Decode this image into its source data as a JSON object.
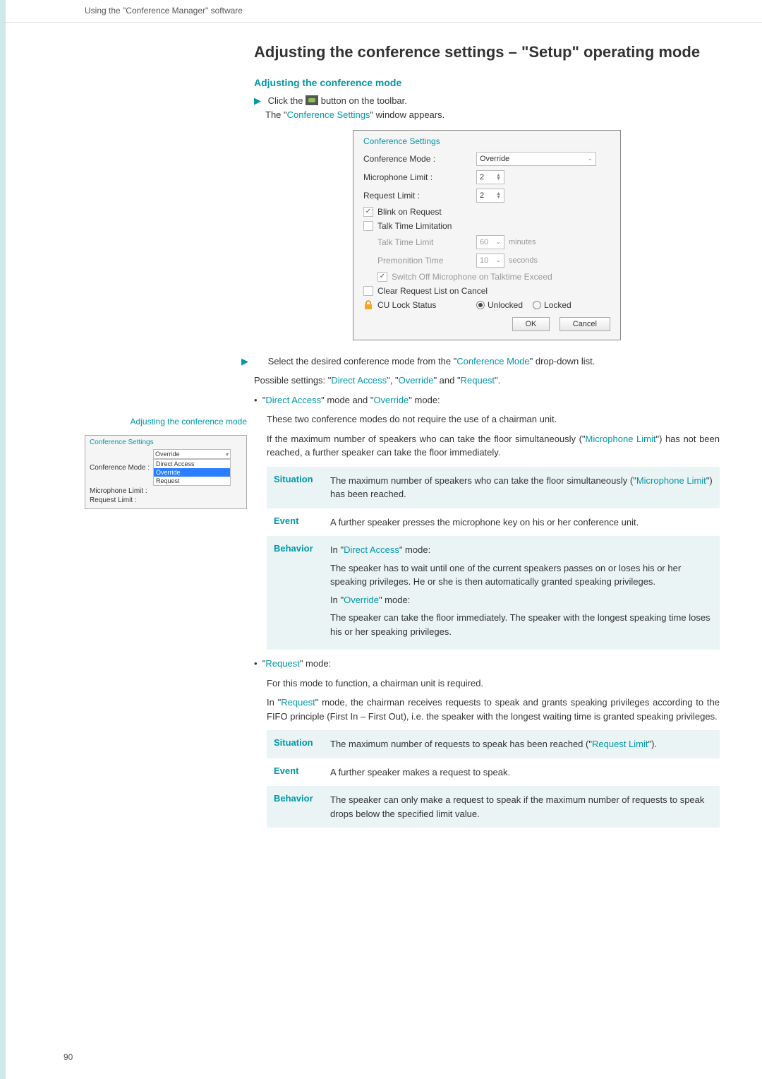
{
  "header": {
    "breadcrumb": "Using the \"Conference Manager\" software"
  },
  "title": "Adjusting the conference settings – \"Setup\" operating mode",
  "sec1": {
    "heading": "Adjusting the conference mode",
    "step1a": "Click the ",
    "step1b": " button on the toolbar.",
    "step2a": "The \"",
    "step2_link": "Conference Settings",
    "step2b": "\" window appears."
  },
  "dialog": {
    "title": "Conference Settings",
    "confmode_lbl": "Conference Mode :",
    "confmode_val": "Override",
    "miclimit_lbl": "Microphone Limit :",
    "miclimit_val": "2",
    "reqlimit_lbl": "Request Limit :",
    "reqlimit_val": "2",
    "blink": "Blink on Request",
    "ttl": "Talk Time Limitation",
    "ttl_lbl": "Talk Time Limit",
    "ttl_val": "60",
    "ttl_unit": "minutes",
    "prem_lbl": "Premonition Time",
    "prem_val": "10",
    "prem_unit": "seconds",
    "switchoff": "Switch Off Microphone on Talktime Exceed",
    "clear": "Clear Request List on Cancel",
    "culock": "CU Lock Status",
    "unlocked": "Unlocked",
    "locked": "Locked",
    "ok": "OK",
    "cancel": "Cancel"
  },
  "side": {
    "label": "Adjusting the conference mode",
    "title": "Conference Settings",
    "confmode_lbl": "Conference Mode :",
    "miclimit_lbl": "Microphone Limit :",
    "reqlimit_lbl": "Request Limit :",
    "combo_val": "Override",
    "opts": {
      "a": "Direct Access",
      "b": "Override",
      "c": "Request"
    }
  },
  "body": {
    "select_a": "Select the desired conference mode from the \"",
    "select_link": "Conference Mode",
    "select_b": "\" drop-down list.",
    "possible_a": "Possible settings: \"",
    "da": "Direct Access",
    "possible_b": "\", \"",
    "ov": "Override",
    "possible_c": "\" and \"",
    "rq": "Request",
    "possible_d": "\".",
    "line1a": "\"",
    "line1b": "\" mode and \"",
    "line1c": "\" mode:",
    "line2": "These two conference modes do not require the use of a chairman unit.",
    "line3a": "If the maximum number of speakers who can take the floor simultaneously (\"",
    "ml": "Microphone Limit",
    "line3b": "\") has not been reached, a further speaker can take the floor immediately.",
    "t1": {
      "sit_h": "Situation",
      "sit_a": "The maximum number of speakers who can take the floor simultaneously (\"",
      "sit_b": "\") has been reached.",
      "ev_h": "Event",
      "ev": "A further speaker presses the microphone key on his or her conference unit.",
      "be_h": "Behavior",
      "be1a": "In \"",
      "be1b": "\" mode:",
      "be1c": "The speaker has to wait until one of the current speakers passes on or loses his or her speaking privileges. He or she is then auto­matically granted speaking privileges.",
      "be2a": "In \"",
      "be2b": "\" mode:",
      "be2c": "The speaker can take the floor immediately. The speaker with the longest speaking time loses his or her speaking privileges."
    },
    "rq_a": "\"",
    "rq_b": "\" mode:",
    "rq_l1": "For this mode to function, a chairman unit is required.",
    "rq_l2a": "In \"",
    "rq_l2b": "\" mode, the chairman receives requests to speak and grants speaking privileges according to the FIFO principle (First In – First Out), i.e. the speaker with the longest waiting time is granted speaking privileges.",
    "t2": {
      "sit_h": "Situation",
      "sit_a": "The maximum number of requests to speak has been reached (\"",
      "rl": "Request Limit",
      "sit_b": "\").",
      "ev_h": "Event",
      "ev": "A further speaker makes a request to speak.",
      "be_h": "Behavior",
      "be": "The speaker can only make a request to speak if the maximum number of requests to speak drops below the specified limit value."
    }
  },
  "pagenum": "90"
}
